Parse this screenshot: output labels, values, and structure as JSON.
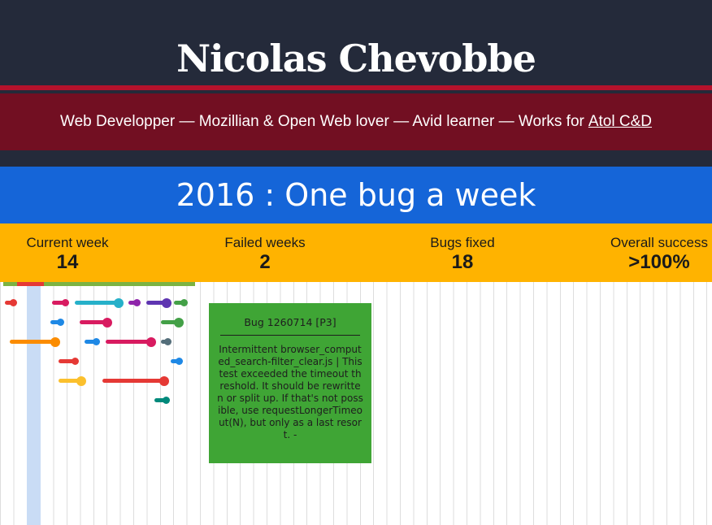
{
  "header": {
    "site_title": "Nicolas Chevobbe",
    "tagline": "Web Developper — Mozillian & Open Web lover — Avid learner — Works for",
    "employer_link": "Atol C&D"
  },
  "banner": {
    "title": "2016 : One bug a week"
  },
  "stats": [
    {
      "label": "Current week",
      "value": "14"
    },
    {
      "label": "Failed weeks",
      "value": "2"
    },
    {
      "label": "Bugs fixed",
      "value": "18"
    },
    {
      "label": "Overall success",
      "value": ">100%"
    }
  ],
  "timeline": {
    "current_week": 14,
    "failed_weeks": 2,
    "colors": {
      "success": "#7cb342",
      "failed": "#e53935",
      "current_week_highlight": "#c9dcf5",
      "grid": "#dddddd"
    },
    "bug_colors": [
      "#e53935",
      "#d81b60",
      "#26b0c9",
      "#8e24aa",
      "#5e35b1",
      "#43a047",
      "#1e88e5",
      "#fb8c00",
      "#546e7a",
      "#fbc02d",
      "#00897b"
    ]
  },
  "tooltip": {
    "title": "Bug 1260714 [P3]",
    "body": "Intermittent browser_computed_search-filter_clear.js | This test exceeded the timeout threshold. It should be rewritten or split up. If that's not possible, use requestLongerTimeout(N), but only as a last resort. -",
    "color": "#3fa535"
  }
}
